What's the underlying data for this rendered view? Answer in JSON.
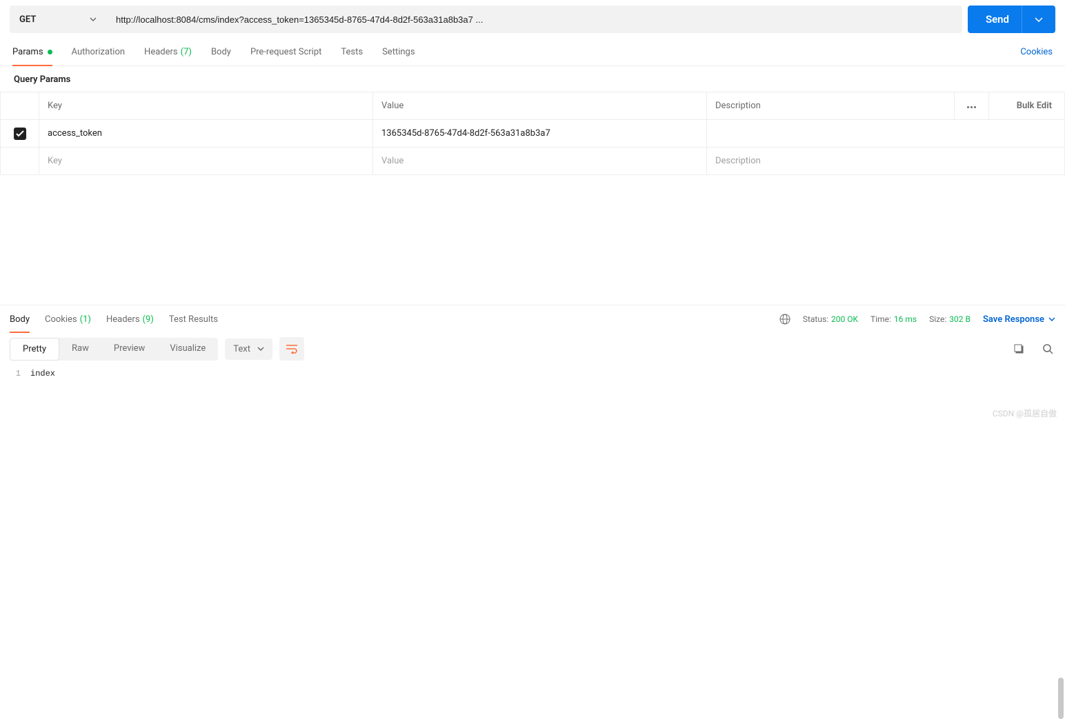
{
  "request": {
    "method": "GET",
    "url": "http://localhost:8084/cms/index?access_token=1365345d-8765-47d4-8d2f-563a31a8b3a7 ...",
    "send_label": "Send"
  },
  "req_tabs": {
    "params": "Params",
    "authorization": "Authorization",
    "headers": "Headers",
    "headers_count": "(7)",
    "body": "Body",
    "prerequest": "Pre-request Script",
    "tests": "Tests",
    "settings": "Settings",
    "cookies": "Cookies"
  },
  "params_section": {
    "title": "Query Params",
    "headers": {
      "key": "Key",
      "value": "Value",
      "description": "Description",
      "bulk": "Bulk Edit"
    },
    "rows": [
      {
        "checked": true,
        "key": "access_token",
        "value": "1365345d-8765-47d4-8d2f-563a31a8b3a7",
        "description": ""
      }
    ],
    "placeholders": {
      "key": "Key",
      "value": "Value",
      "description": "Description"
    }
  },
  "resp_tabs": {
    "body": "Body",
    "cookies": "Cookies",
    "cookies_count": "(1)",
    "headers": "Headers",
    "headers_count": "(9)",
    "test_results": "Test Results"
  },
  "status": {
    "status_label": "Status:",
    "status_value": "200 OK",
    "time_label": "Time:",
    "time_value": "16 ms",
    "size_label": "Size:",
    "size_value": "302 B",
    "save": "Save Response"
  },
  "resp_toolbar": {
    "pretty": "Pretty",
    "raw": "Raw",
    "preview": "Preview",
    "visualize": "Visualize",
    "format": "Text"
  },
  "response_body": {
    "lines": [
      {
        "num": "1",
        "text": "index"
      }
    ]
  },
  "watermark": "CSDN @孤居自傲"
}
